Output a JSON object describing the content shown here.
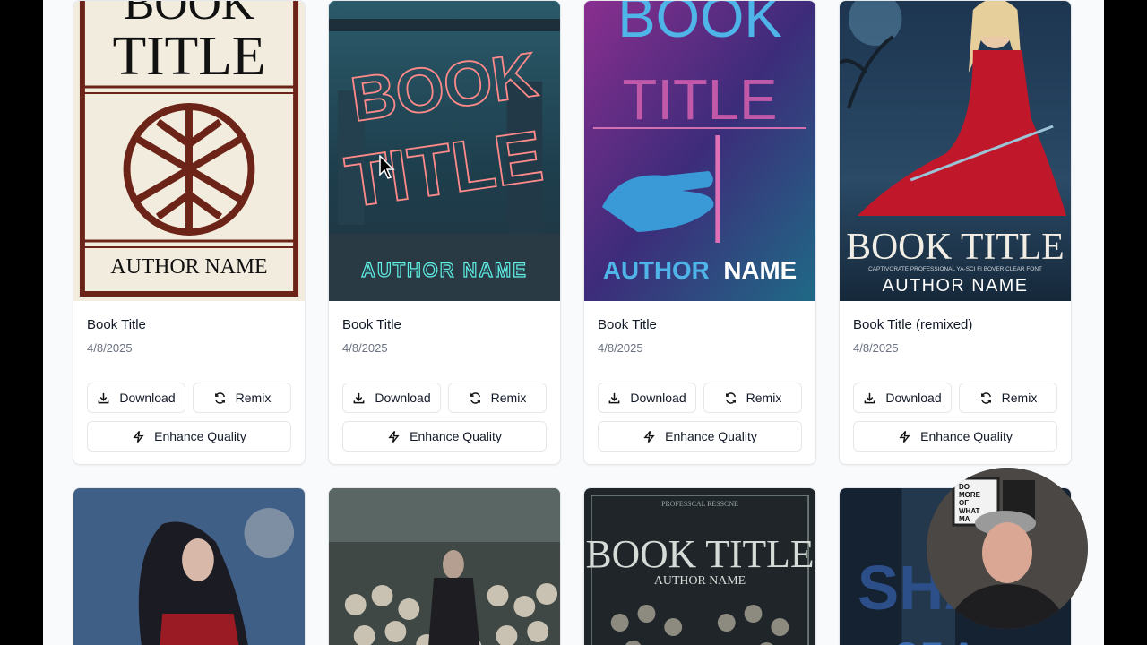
{
  "cards": [
    {
      "title": "Book Title",
      "date": "4/8/2025",
      "cover": {
        "line1": "BOOK",
        "line2": "TITLE",
        "author": "AUTHOR NAME"
      }
    },
    {
      "title": "Book Title",
      "date": "4/8/2025",
      "cover": {
        "line1": "BOOK",
        "line2": "TITLE",
        "author": "AUTHOR NAME"
      }
    },
    {
      "title": "Book Title",
      "date": "4/8/2025",
      "cover": {
        "line1": "BOOK",
        "line2": "TITLE",
        "author_a": "AUTHOR",
        "author_b": "NAME"
      }
    },
    {
      "title": "Book Title (remixed)",
      "date": "4/8/2025",
      "cover": {
        "title": "BOOK TITLE",
        "tagline": "CAPTIVORATE PROFESSIONAL YA-SCI FI BOVER CLEAR FONT",
        "author": "AUTHOR NAME"
      }
    }
  ],
  "row2": [
    {
      "cover": {}
    },
    {
      "cover": {}
    },
    {
      "cover": {
        "top": "PROFESSCAL RESSCNE",
        "title": "BOOK TITLE",
        "author": "AUTHOR NAME"
      }
    },
    {
      "cover": {
        "title1": "SHA",
        "title2": "OF A"
      }
    }
  ],
  "buttons": {
    "download": "Download",
    "remix": "Remix",
    "enhance": "Enhance Quality"
  },
  "webcam": {
    "sign_lines": [
      "DO",
      "MORE",
      "OF",
      "WHAT",
      "MA"
    ]
  }
}
